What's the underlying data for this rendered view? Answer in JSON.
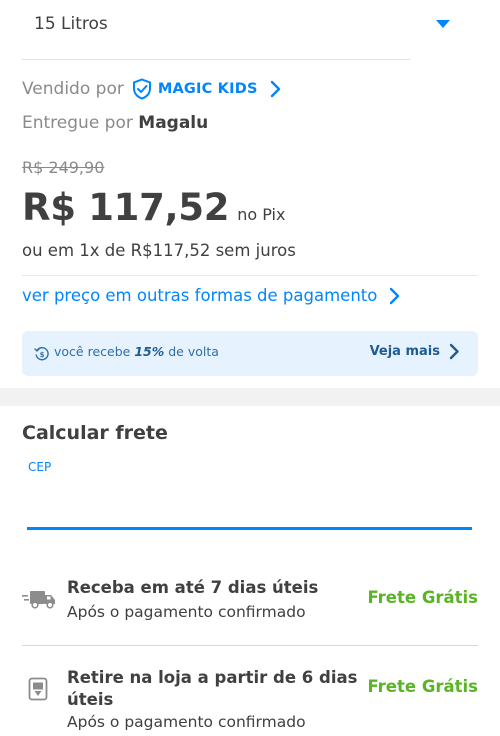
{
  "product": {
    "selected_variant": "15 Litros"
  },
  "seller": {
    "sold_by_label": "Vendido por",
    "seller_name": "MAGIC KIDS",
    "delivered_by_label": "Entregue por",
    "delivered_by_name": "Magalu"
  },
  "pricing": {
    "old_price": "R$ 249,90",
    "price": "R$ 117,52",
    "price_suffix": "no Pix",
    "installments": "ou em 1x de R$117,52 sem juros",
    "other_payments_link": "ver preço em outras formas de pagamento"
  },
  "cashback": {
    "text_before": "você recebe",
    "percent": "15%",
    "text_after": "de volta",
    "more_link": "Veja mais"
  },
  "freight": {
    "title": "Calcular frete",
    "cep_label": "CEP",
    "cep_value": "",
    "options": [
      {
        "title": "Receba em até 7 dias úteis",
        "subtitle": "Após o pagamento confirmado",
        "price": "Frete Grátis",
        "icon": "truck-icon"
      },
      {
        "title_line1": "Retire na loja a partir de 6 dias",
        "title_line2": "úteis",
        "subtitle": "Após o pagamento confirmado",
        "price": "Frete Grátis",
        "icon": "store-pickup-icon"
      }
    ]
  },
  "colors": {
    "accent": "#0086ff",
    "free_shipping": "#5ab524",
    "cashback_bg": "#e6f3ff",
    "text": "#404040",
    "muted": "#8a8a8a"
  }
}
